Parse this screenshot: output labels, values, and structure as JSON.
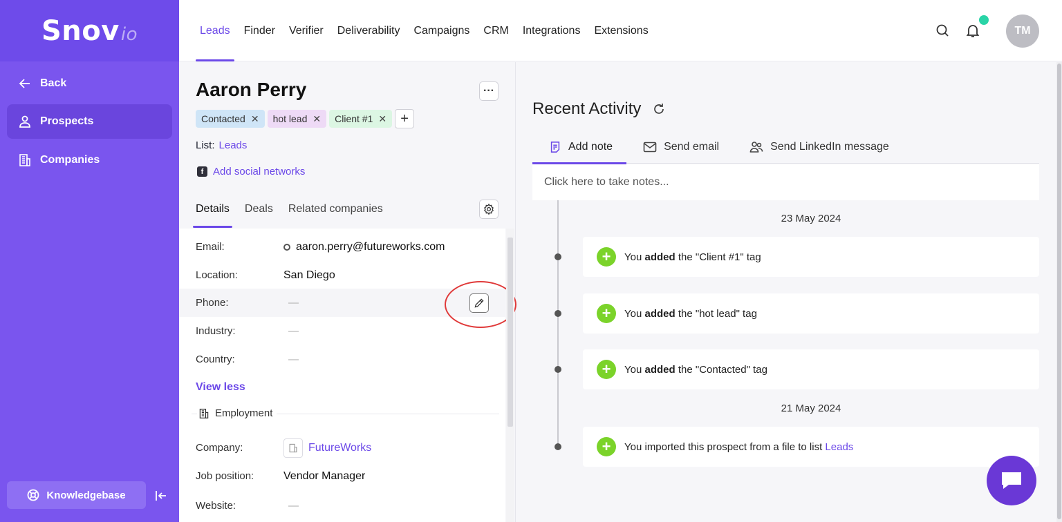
{
  "brand": {
    "logo_main": "Snov",
    "logo_suffix": "io"
  },
  "sidebar": {
    "back_label": "Back",
    "items": [
      {
        "label": "Prospects",
        "active": true
      },
      {
        "label": "Companies",
        "active": false
      }
    ],
    "knowledgebase_label": "Knowledgebase"
  },
  "nav": {
    "items": [
      "Leads",
      "Finder",
      "Verifier",
      "Deliverability",
      "Campaigns",
      "CRM",
      "Integrations",
      "Extensions"
    ],
    "active": "Leads",
    "avatar_initials": "TM"
  },
  "prospect": {
    "name": "Aaron Perry",
    "more_label": "···",
    "tags": [
      {
        "label": "Contacted",
        "color": "#cfe5f7"
      },
      {
        "label": "hot lead",
        "color": "#eedaf6"
      },
      {
        "label": "Client #1",
        "color": "#dcf6e3"
      }
    ],
    "list_label": "List:",
    "list_value": "Leads",
    "add_social_label": "Add social networks",
    "tabs": [
      "Details",
      "Deals",
      "Related companies"
    ],
    "active_tab": "Details",
    "details": {
      "email_label": "Email:",
      "email_value": "aaron.perry@futureworks.com",
      "location_label": "Location:",
      "location_value": "San Diego",
      "phone_label": "Phone:",
      "phone_value": "—",
      "industry_label": "Industry:",
      "industry_value": "—",
      "country_label": "Country:",
      "country_value": "—"
    },
    "view_less_label": "View less",
    "employment": {
      "section_title": "Employment",
      "company_label": "Company:",
      "company_value": "FutureWorks",
      "job_label": "Job position:",
      "job_value": "Vendor Manager",
      "website_label": "Website:",
      "website_value": "—"
    }
  },
  "activity": {
    "title": "Recent Activity",
    "tabs": [
      "Add note",
      "Send email",
      "Send LinkedIn message"
    ],
    "active_tab": "Add note",
    "note_placeholder": "Click here to take notes...",
    "dates": [
      "23 May 2024",
      "21 May 2024"
    ],
    "entries": [
      {
        "prefix": "You",
        "bold": "added",
        "suffix": "the \"Client #1\" tag"
      },
      {
        "prefix": "You",
        "bold": "added",
        "suffix": "the \"hot lead\" tag"
      },
      {
        "prefix": "You",
        "bold": "added",
        "suffix": "the \"Contacted\" tag"
      }
    ],
    "import_entry": {
      "text": "You imported this prospect from a file to list",
      "link": "Leads"
    }
  },
  "colors": {
    "accent": "#6b48e8",
    "sidebar": "#7a55ee",
    "success": "#7bd32a",
    "annotation": "#e03a3a"
  }
}
